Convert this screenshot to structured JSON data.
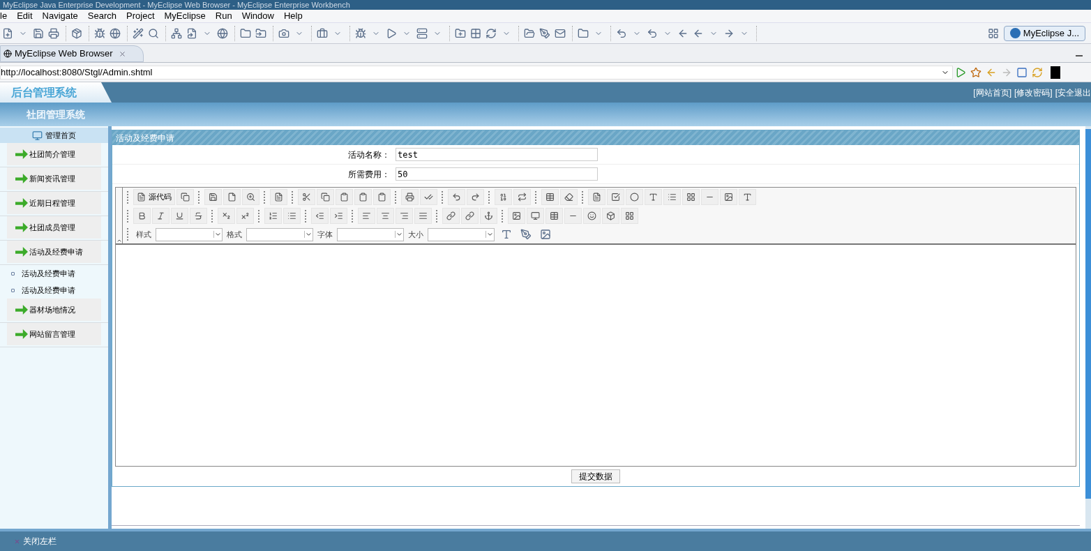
{
  "window": {
    "title": "MyEclipse Java Enterprise Development - MyEclipse Web Browser - MyEclipse Enterprise Workbench"
  },
  "menu": [
    "le",
    "Edit",
    "Navigate",
    "Search",
    "Project",
    "MyEclipse",
    "Run",
    "Window",
    "Help"
  ],
  "perspective": {
    "label": "MyEclipse J..."
  },
  "editor_tab": {
    "label": "MyEclipse Web Browser"
  },
  "address_bar": {
    "value": "http://localhost:8080/Stgl/Admin.shtml"
  },
  "page": {
    "logo": "后台管理系统",
    "top_links": [
      "[网站首页]",
      "[修改密码]",
      "[安全退出"
    ],
    "system_title": "社团管理系统",
    "sidebar": {
      "home": "管理首页",
      "items": [
        {
          "kind": "menu",
          "label": "社团简介管理"
        },
        {
          "kind": "menu",
          "label": "新闻资讯管理"
        },
        {
          "kind": "menu",
          "label": "近期日程管理"
        },
        {
          "kind": "menu",
          "label": "社团成员管理"
        },
        {
          "kind": "menu",
          "label": "活动及经费申请"
        },
        {
          "kind": "sub",
          "label": "活动及经费申请"
        },
        {
          "kind": "sub",
          "label": "活动及经费申请"
        },
        {
          "kind": "menu",
          "label": "器材场地情况"
        },
        {
          "kind": "menu",
          "label": "网站留言管理"
        }
      ]
    },
    "panel": {
      "title": "活动及经费申请",
      "fields": [
        {
          "label": "活动名称：",
          "value": "test"
        },
        {
          "label": "所需费用：",
          "value": "50"
        }
      ],
      "editor": {
        "source_button": "源代码",
        "dropdowns": [
          "样式",
          "格式",
          "字体",
          "大小"
        ]
      },
      "submit": "提交数据"
    },
    "footer": {
      "close_sidebar": "关闭左栏"
    }
  }
}
